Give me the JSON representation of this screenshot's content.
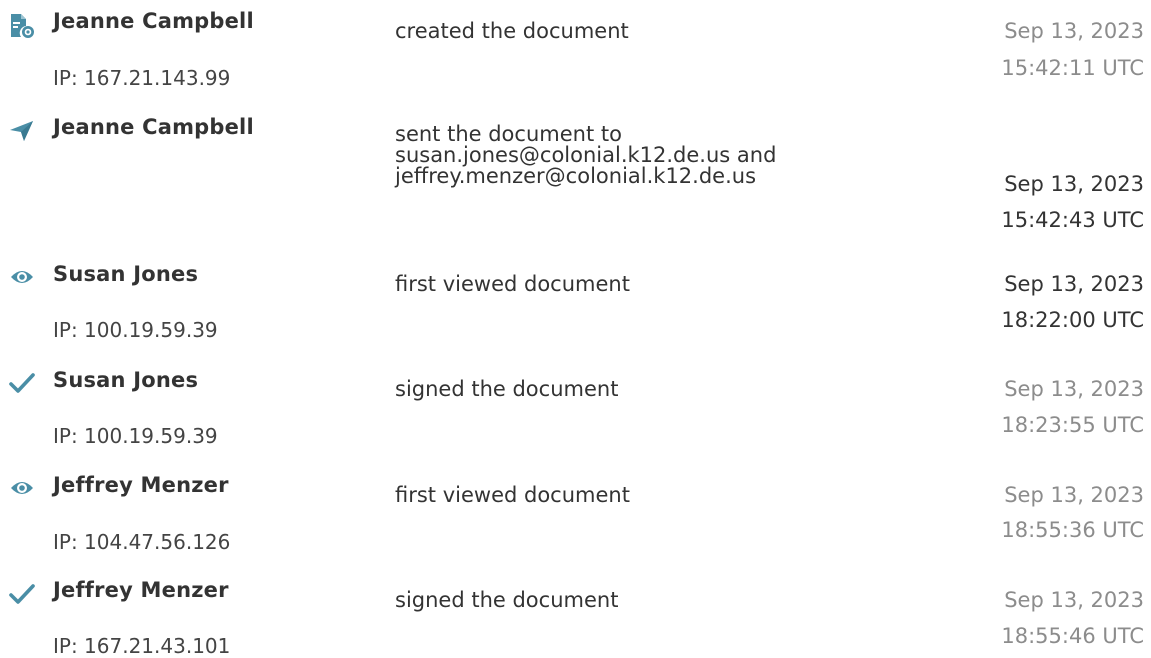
{
  "colors": {
    "icon_accent": "#4a8ea6",
    "text_dark": "#333333",
    "text_muted": "#8c8c8c"
  },
  "events": [
    {
      "icon": "document-created-icon",
      "name": "Jeanne Campbell",
      "ip": "IP: 167.21.143.99",
      "action": "created the document",
      "date": "Sep 13, 2023",
      "time": "15:42:11 UTC"
    },
    {
      "icon": "paper-plane-icon",
      "name": "Jeanne Campbell",
      "action_lines": [
        "sent the document to",
        "susan.jones@colonial.k12.de.us and",
        "jeffrey.menzer@colonial.k12.de.us"
      ],
      "date": "Sep 13, 2023",
      "time": "15:42:43 UTC"
    },
    {
      "icon": "eye-icon",
      "name": "Susan Jones",
      "ip": "IP: 100.19.59.39",
      "action": "first viewed document",
      "date": "Sep 13, 2023",
      "time": "18:22:00 UTC"
    },
    {
      "icon": "checkmark-icon",
      "name": "Susan Jones",
      "ip": "IP: 100.19.59.39",
      "action": "signed the document",
      "date": "Sep 13, 2023",
      "time": "18:23:55 UTC"
    },
    {
      "icon": "eye-icon",
      "name": "Jeffrey Menzer",
      "ip": "IP: 104.47.56.126",
      "action": "first viewed document",
      "date": "Sep 13, 2023",
      "time": "18:55:36 UTC"
    },
    {
      "icon": "checkmark-icon",
      "name": "Jeffrey Menzer",
      "ip": "IP: 167.21.43.101",
      "action": "signed the document",
      "date": "Sep 13, 2023",
      "time": "18:55:46 UTC"
    }
  ]
}
